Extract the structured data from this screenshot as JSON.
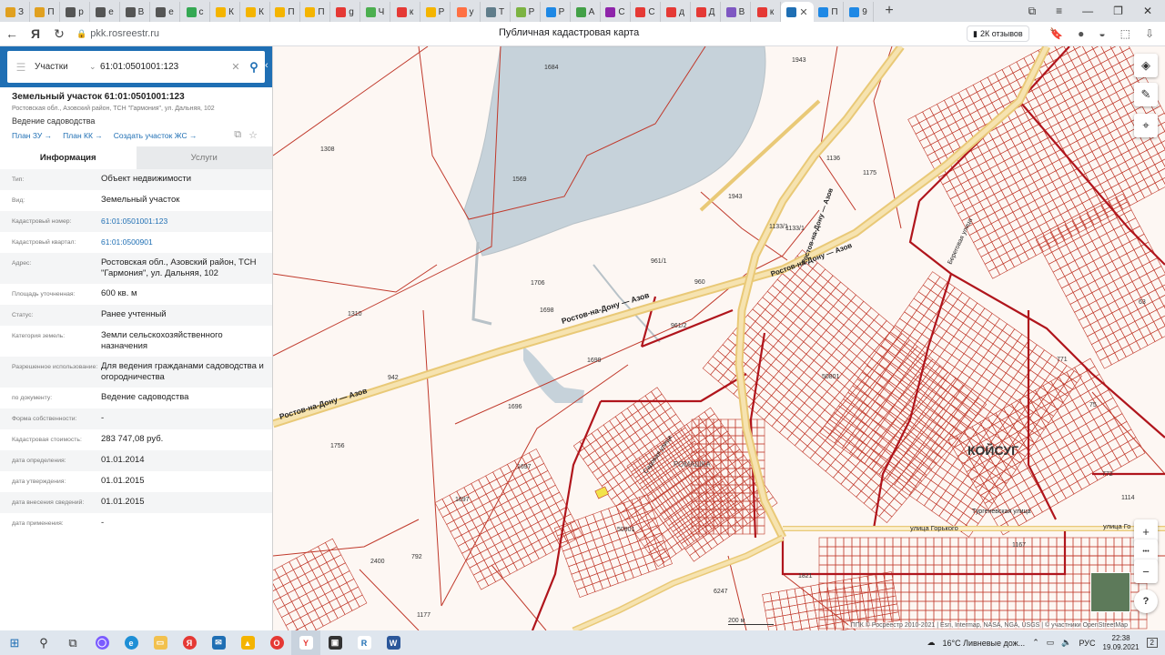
{
  "browser": {
    "tabs": [
      {
        "label": "З",
        "color": "#e0a020"
      },
      {
        "label": "П",
        "color": "#e0a020"
      },
      {
        "label": "p",
        "color": "#555555"
      },
      {
        "label": "e",
        "color": "#555555"
      },
      {
        "label": "В",
        "color": "#555555"
      },
      {
        "label": "e",
        "color": "#555555"
      },
      {
        "label": "с",
        "color": "#34a853"
      },
      {
        "label": "К",
        "color": "#f4b400"
      },
      {
        "label": "К",
        "color": "#f4b400"
      },
      {
        "label": "П",
        "color": "#f4b400"
      },
      {
        "label": "П",
        "color": "#f4b400"
      },
      {
        "label": "g",
        "color": "#e53935"
      },
      {
        "label": "Ч",
        "color": "#4caf50"
      },
      {
        "label": "к",
        "color": "#e53935"
      },
      {
        "label": "Р",
        "color": "#f4b400"
      },
      {
        "label": "у",
        "color": "#ff7043"
      },
      {
        "label": "Т",
        "color": "#607d8b"
      },
      {
        "label": "Р",
        "color": "#7cb342"
      },
      {
        "label": "Р",
        "color": "#1e88e5"
      },
      {
        "label": "А",
        "color": "#43a047"
      },
      {
        "label": "С",
        "color": "#8e24aa"
      },
      {
        "label": "С",
        "color": "#e53935"
      },
      {
        "label": "д",
        "color": "#e53935"
      },
      {
        "label": "Д",
        "color": "#e53935"
      },
      {
        "label": "В",
        "color": "#7e57c2"
      },
      {
        "label": "к",
        "color": "#e53935"
      }
    ],
    "active_tab_close": "✕",
    "extra_tabs": [
      {
        "label": "П",
        "color": "#1e88e5"
      },
      {
        "label": "9",
        "color": "#1e88e5"
      }
    ],
    "new_tab": "+",
    "url": "pkk.rosreestr.ru",
    "page_title": "Публичная кадастровая карта",
    "reviews": "2К отзывов"
  },
  "search": {
    "type": "Участки",
    "value": "61:01:0501001:123"
  },
  "object": {
    "title": "Земельный участок 61:01:0501001:123",
    "address": "Ростовская обл., Азовский район, ТСН \"Гармония\", ул. Дальняя, 102",
    "use": "Ведение садоводства",
    "links": [
      "План ЗУ →",
      "План КК →",
      "Создать участок ЖС →"
    ]
  },
  "tabs": {
    "info": "Информация",
    "services": "Услуги"
  },
  "attributes": [
    {
      "label": "Тип:",
      "value": "Объект недвижимости"
    },
    {
      "label": "Вид:",
      "value": "Земельный участок"
    },
    {
      "label": "Кадастровый номер:",
      "value": "61:01:0501001:123",
      "link": true
    },
    {
      "label": "Кадастровый квартал:",
      "value": "61:01:0500901",
      "link": true
    },
    {
      "label": "Адрес:",
      "value": "Ростовская обл., Азовский район, ТСН \"Гармония\", ул. Дальняя, 102"
    },
    {
      "label": "Площадь уточненная:",
      "value": "600 кв. м"
    },
    {
      "label": "Статус:",
      "value": "Ранее учтенный"
    },
    {
      "label": "Категория земель:",
      "value": "Земли сельскохозяйственного назначения"
    },
    {
      "label": "Разрешенное использование:",
      "value": "Для ведения гражданами садоводства и огородничества"
    },
    {
      "label": "по документу:",
      "value": "Ведение садоводства"
    },
    {
      "label": "Форма собственности:",
      "value": "-"
    },
    {
      "label": "Кадастровая стоимость:",
      "value": "283 747,08 руб."
    },
    {
      "label": "дата определения:",
      "value": "01.01.2014"
    },
    {
      "label": "дата утверждения:",
      "value": "01.01.2015"
    },
    {
      "label": "дата внесения сведений:",
      "value": "01.01.2015"
    },
    {
      "label": "дата применения:",
      "value": "-"
    }
  ],
  "map": {
    "town": "КОЙСУГ",
    "settlement": "РОМАШКА",
    "road1": "Ростов-на-Дону — Азов",
    "road2": "Ростов-на-Дону — Азов",
    "road3": "Ростов-на-Дону — Азов",
    "road4": "Ростов-на-Дону — Азов",
    "street1": "улица Горького",
    "street2": "улица Го",
    "street3": "Тургеневская улица",
    "street4": "Береговая улица",
    "street5": "Садовая улица",
    "parcel_labels": [
      "1684",
      "1943",
      "1308",
      "1569",
      "1136",
      "1175",
      "1943",
      "1133/1",
      "1133/1",
      "961/1",
      "1706",
      "960",
      "1310",
      "1698",
      "961/2",
      "1699",
      "942",
      "1696",
      "1756",
      "1697",
      "1697",
      "2400",
      "792",
      "1177",
      "1821",
      "6247",
      "50901",
      "50801",
      "1167",
      "1114",
      "772",
      "771",
      "75",
      "63"
    ],
    "scale": "200 м",
    "attribution": "ППК © Росреестр 2010-2021 | Esri, Intermap, NASA, NGA, USGS | © участники OpenStreetMap",
    "tools": [
      "layers-icon",
      "ruler-icon",
      "locate-icon"
    ],
    "zoom_in": "+",
    "zoom_dots": "•••",
    "zoom_out": "−",
    "info": "?"
  },
  "taskbar": {
    "weather": "16°C  Ливневые дож...",
    "lang": "РУС",
    "time": "22:38",
    "date": "19.09.2021",
    "notif": "2"
  }
}
